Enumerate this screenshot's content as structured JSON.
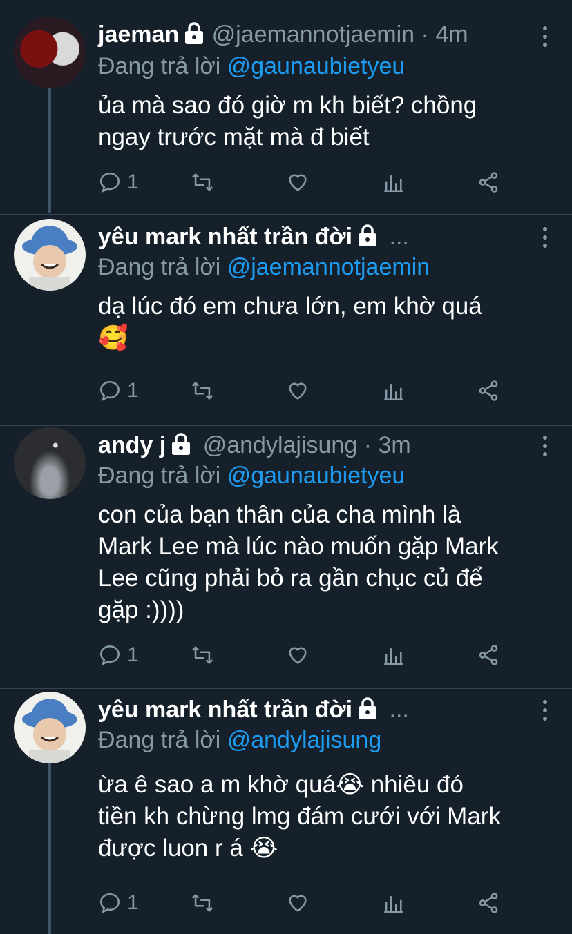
{
  "tweets": [
    {
      "name": "jaeman",
      "handle": "@jaemannotjaemin",
      "time": "· 4m",
      "reply_prefix": "Đang trả lời ",
      "reply_to": "@gaunaubietyeu",
      "text": "ủa mà sao đó giờ m kh biết? chồng\nngay trước mặt mà đ biết",
      "reply_count": "1",
      "avatar_icon": "avatar-spiderman"
    },
    {
      "name": "yêu mark nhất trần đời",
      "handle": "...",
      "time": "",
      "reply_prefix": "Đang trả lời ",
      "reply_to": "@jaemannotjaemin",
      "text": "dạ lúc đó em chưa lớn, em khờ quá\n🥰",
      "reply_count": "1",
      "avatar_icon": "avatar-bucket-hat"
    },
    {
      "name": "andy j",
      "handle": "@andylajisung",
      "time": "· 3m",
      "reply_prefix": "Đang trả lời ",
      "reply_to": "@gaunaubietyeu",
      "text": "con của bạn thân của cha mình là\nMark Lee mà lúc nào muốn gặp Mark\nLee cũng phải bỏ ra gần chục củ để\ngặp :))))",
      "reply_count": "1",
      "avatar_icon": "avatar-dark-room"
    },
    {
      "name": "yêu mark nhất trần đời",
      "handle": "...",
      "time": "",
      "reply_prefix": "Đang trả lời ",
      "reply_to": "@andylajisung",
      "text": "ừa ê sao a m khờ quá😭 nhiêu đó\ntiền kh chừng lmg đám cưới với Mark\nđược luon r á 😭",
      "reply_count": "1",
      "avatar_icon": "avatar-bucket-hat"
    }
  ],
  "colors": {
    "background": "#15202b",
    "secondary_text": "#8899a6",
    "mention": "#1d9bf0",
    "divider": "#38444d"
  }
}
